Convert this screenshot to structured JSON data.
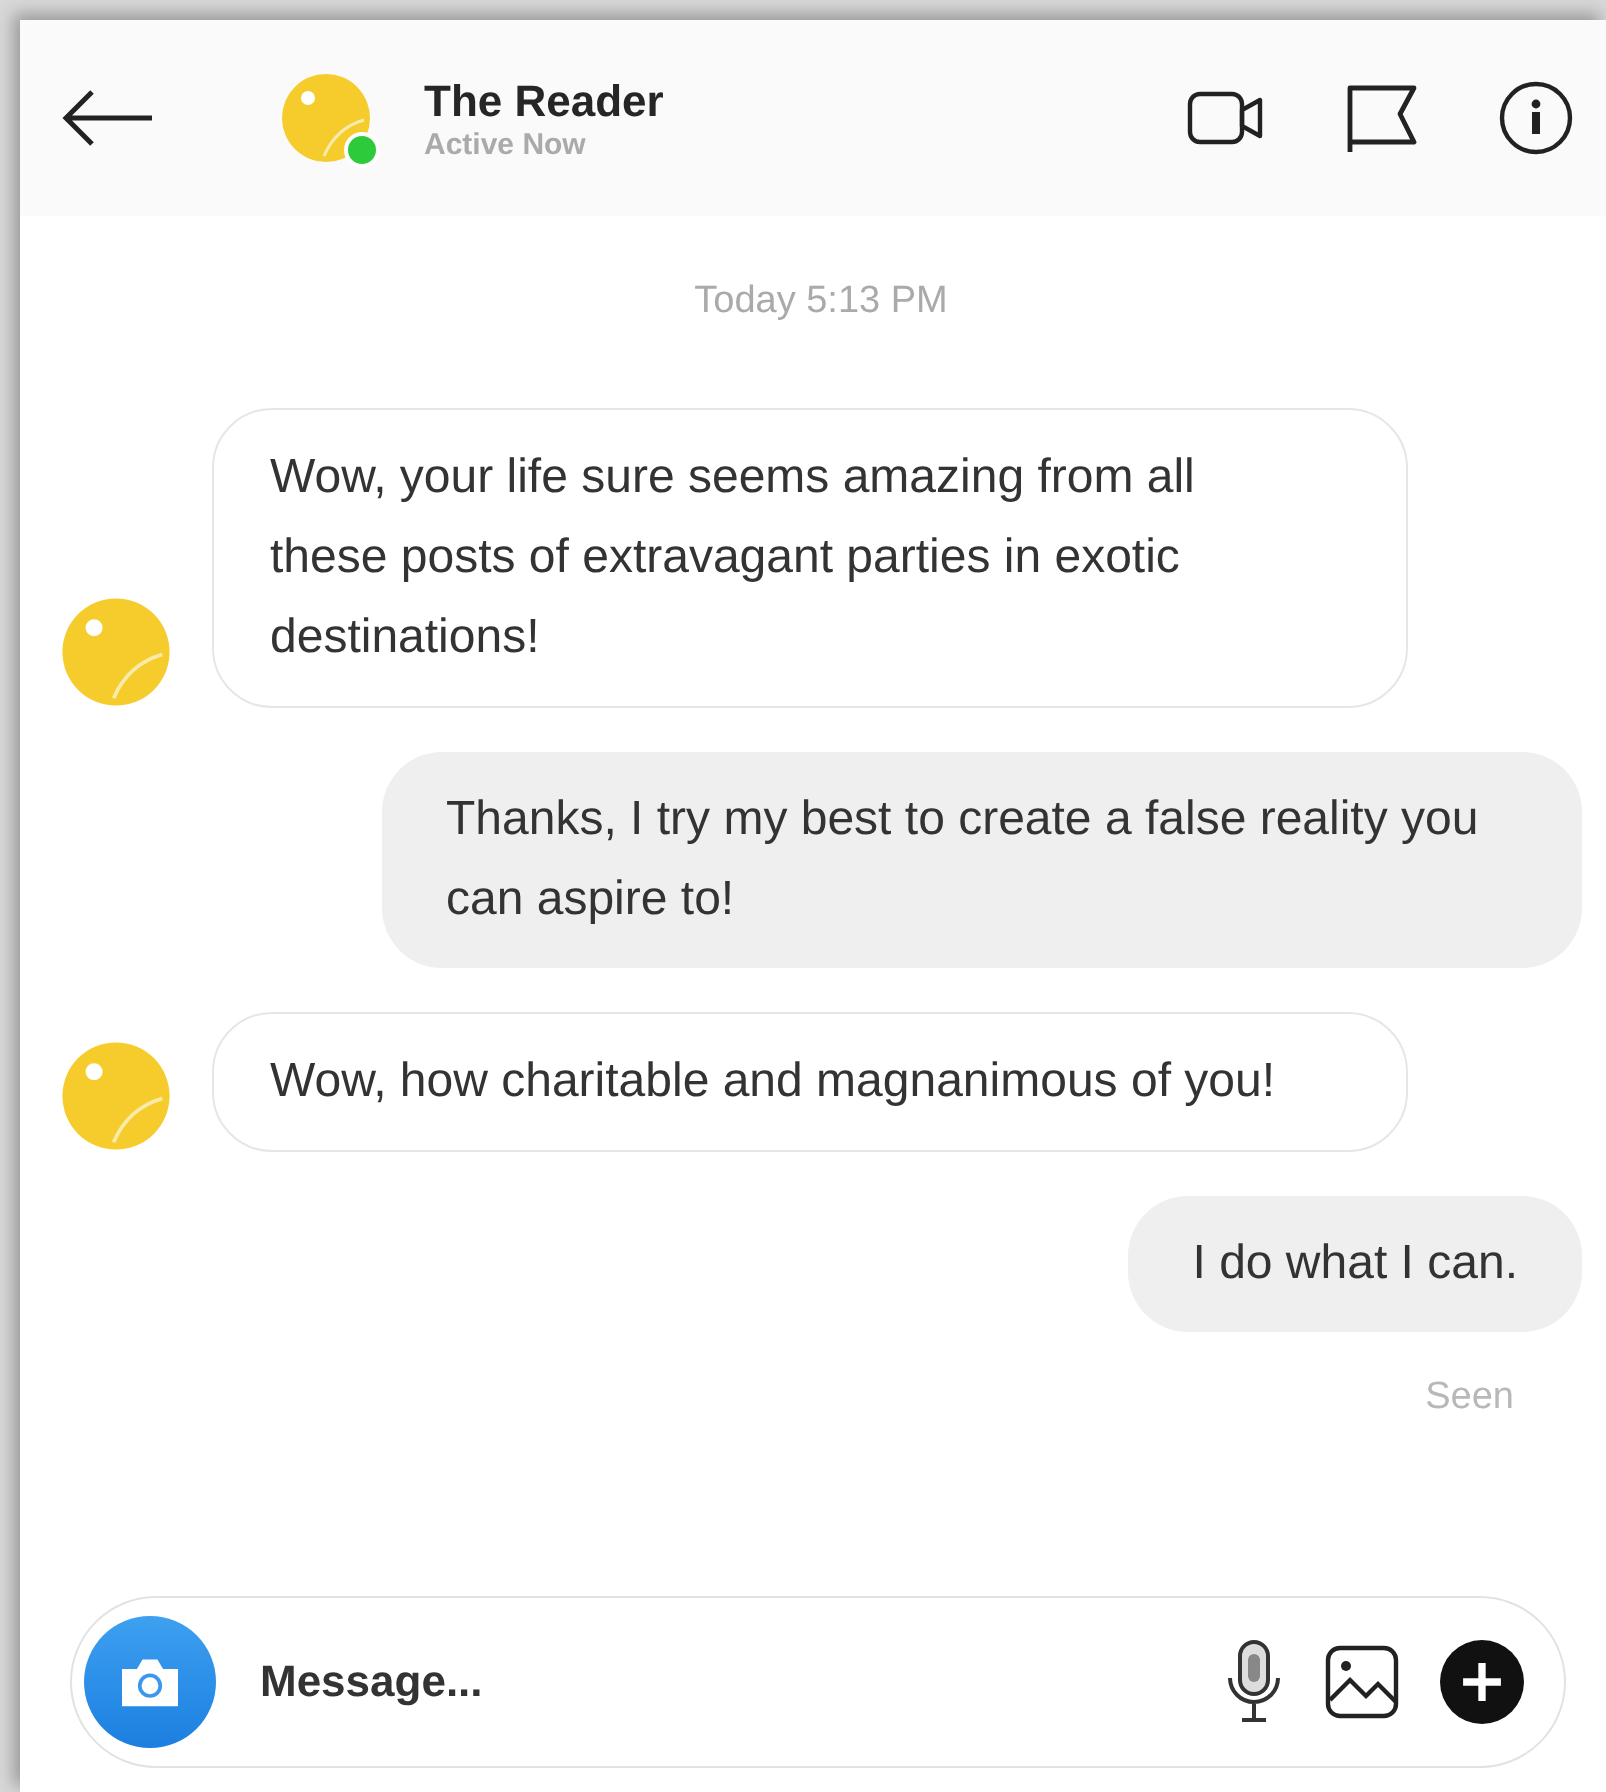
{
  "header": {
    "contact_name": "The Reader",
    "status": "Active Now",
    "online": true
  },
  "timestamp": "Today 5:13 PM",
  "messages": [
    {
      "kind": "received",
      "text": "Wow, your life sure seems amazing from all these posts of extravagant parties in exotic destinations!"
    },
    {
      "kind": "sent",
      "text": "Thanks, I try my best to create a false reality you can aspire to!"
    },
    {
      "kind": "received",
      "text": "Wow, how charitable and magnanimous of you!"
    },
    {
      "kind": "sent",
      "text": "I do what I can."
    }
  ],
  "read_receipt": "Seen",
  "composer": {
    "placeholder": "Message..."
  }
}
